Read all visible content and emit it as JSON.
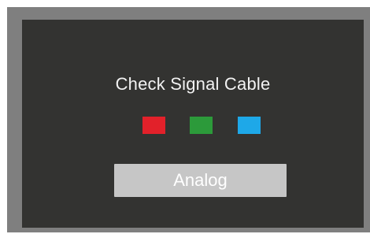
{
  "osd": {
    "message": "Check Signal Cable",
    "input_source": "Analog",
    "colors": {
      "red": "#e2212a",
      "green": "#2c9a3a",
      "blue": "#1ea8e8",
      "screen_background": "#333331",
      "bezel": "#7f7f7f",
      "button_background": "#c6c6c6"
    }
  }
}
